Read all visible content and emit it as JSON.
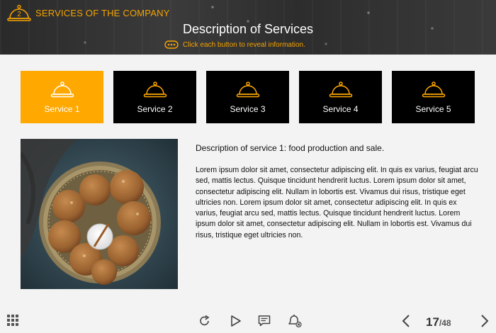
{
  "header": {
    "course_badge_number": "2",
    "course_title": "SERVICES OF THE COMPANY",
    "slide_title": "Description of Services",
    "hint": "Click each button to reveal information."
  },
  "tabs": [
    {
      "label": "Service 1",
      "active": true
    },
    {
      "label": "Service 2",
      "active": false
    },
    {
      "label": "Service 3",
      "active": false
    },
    {
      "label": "Service 4",
      "active": false
    },
    {
      "label": "Service 5",
      "active": false
    }
  ],
  "content": {
    "title": "Description of service 1: food production and sale.",
    "body": "Lorem ipsum dolor sit amet, consectetur adipiscing elit. In quis ex varius, feugiat arcu sed, mattis lectus. Quisque tincidunt hendrerit luctus. Lorem ipsum dolor sit amet, consectetur adipiscing elit. Nullam in lobortis est. Vivamus dui risus, tristique eget ultricies non. Lorem ipsum dolor sit amet, consectetur adipiscing elit. In quis ex varius, feugiat arcu sed, mattis lectus. Quisque tincidunt hendrerit luctus. Lorem ipsum dolor sit amet, consectetur adipiscing elit. Nullam in lobortis est. Vivamus dui risus, tristique eget ultricies non."
  },
  "pager": {
    "current": "17",
    "total": "/48"
  },
  "colors": {
    "accent": "#ffa800",
    "tab_bg": "#000000",
    "header_text": "#f5a300"
  },
  "icons": [
    "menu-grid-icon",
    "replay-icon",
    "play-icon",
    "notes-icon",
    "mute-bell-icon",
    "prev-arrow-icon",
    "next-arrow-icon",
    "service-bell-icon"
  ]
}
